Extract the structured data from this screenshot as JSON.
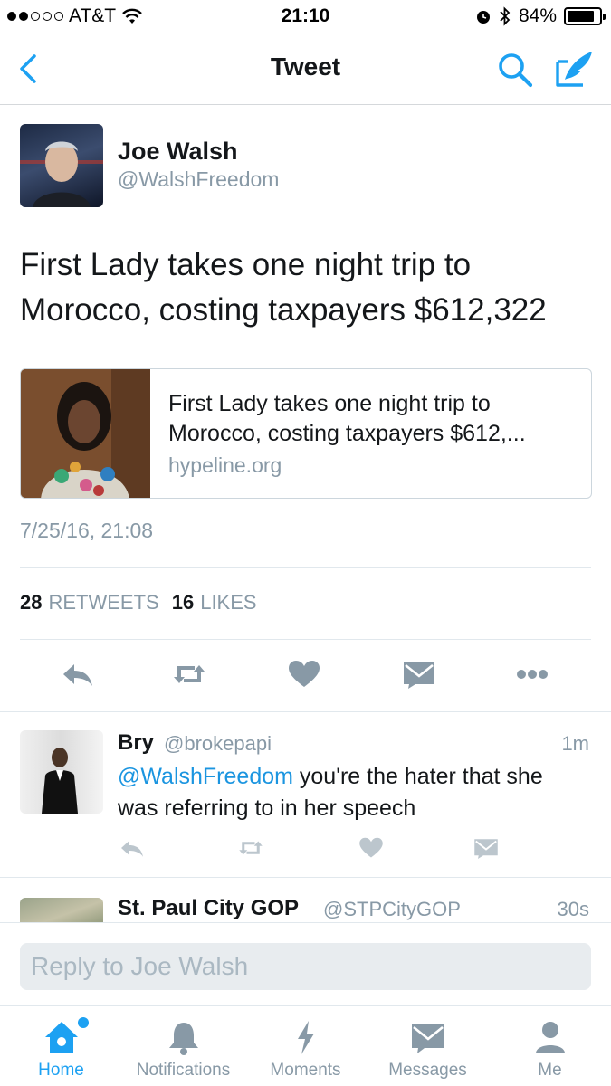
{
  "status_bar": {
    "carrier": "AT&T",
    "time": "21:10",
    "battery": "84%",
    "battery_level": 0.84
  },
  "nav": {
    "title": "Tweet",
    "back_icon": "chevron-left-icon",
    "search_icon": "search-icon",
    "compose_icon": "compose-icon"
  },
  "tweet": {
    "author_name": "Joe Walsh",
    "author_handle": "@WalshFreedom",
    "text": "First Lady takes one night trip to Morocco, costing taxpayers $612,322",
    "card": {
      "title": "First Lady takes one night trip to Morocco, costing taxpayers $612,...",
      "domain": "hypeline.org"
    },
    "timestamp": "7/25/16, 21:08",
    "retweets_count": "28",
    "retweets_label": "RETWEETS",
    "likes_count": "16",
    "likes_label": "LIKES"
  },
  "replies": [
    {
      "name": "Bry",
      "handle": "@brokepapi",
      "time": "1m",
      "mention": "@WalshFreedom",
      "text": " you're the hater that she was referring to in her speech"
    },
    {
      "name": "St. Paul City GOP",
      "handle": "@STPCityGOP",
      "time": "30s"
    }
  ],
  "reply_bar": {
    "placeholder": "Reply to Joe Walsh"
  },
  "tabs": [
    {
      "label": "Home",
      "icon": "home-icon",
      "active": true
    },
    {
      "label": "Notifications",
      "icon": "bell-icon",
      "active": false
    },
    {
      "label": "Moments",
      "icon": "lightning-icon",
      "active": false
    },
    {
      "label": "Messages",
      "icon": "envelope-icon",
      "active": false
    },
    {
      "label": "Me",
      "icon": "person-icon",
      "active": false
    }
  ],
  "colors": {
    "accent": "#1da1f2",
    "muted": "#8899a6",
    "text": "#14171a"
  }
}
